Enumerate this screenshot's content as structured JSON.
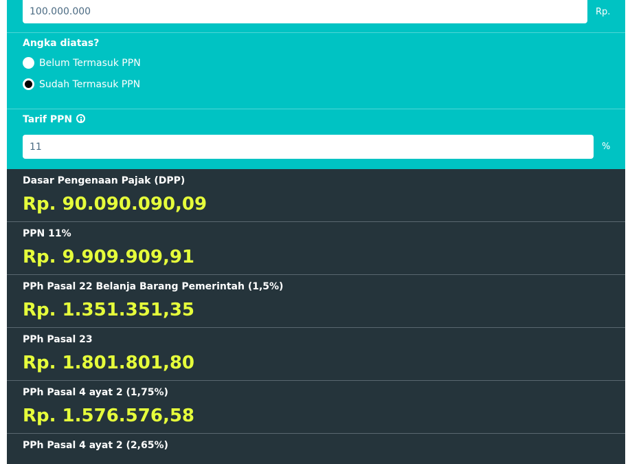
{
  "amount_input": {
    "value": "100.000.000",
    "unit": "Rp."
  },
  "price_basis": {
    "question": "Angka diatas?",
    "options": [
      {
        "label": "Belum Termasuk PPN",
        "selected": false
      },
      {
        "label": "Sudah Termasuk PPN",
        "selected": true
      }
    ]
  },
  "tax_rate": {
    "label": "Tarif PPN",
    "icon": "info-icon",
    "value": "11",
    "unit": "%"
  },
  "results": [
    {
      "title": "Dasar Pengenaan Pajak (DPP)",
      "value": "Rp. 90.090.090,09"
    },
    {
      "title": "PPN 11%",
      "value": "Rp. 9.909.909,91"
    },
    {
      "title": "PPh Pasal 22 Belanja Barang Pemerintah (1,5%)",
      "value": "Rp. 1.351.351,35"
    },
    {
      "title": "PPh Pasal 23",
      "value": "Rp. 1.801.801,80"
    },
    {
      "title": "PPh Pasal 4 ayat 2 (1,75%)",
      "value": "Rp. 1.576.576,58"
    },
    {
      "title": "PPh Pasal 4 ayat 2 (2,65%)",
      "value": ""
    }
  ],
  "colors": {
    "panel": "#00c3c3",
    "result_bg": "#25343b",
    "result_value": "#e6ff3b"
  }
}
